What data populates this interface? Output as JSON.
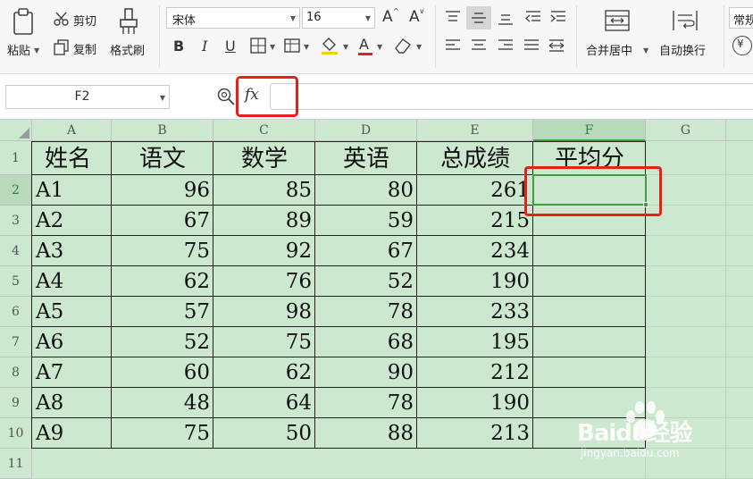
{
  "ribbon": {
    "paste_label": "粘贴",
    "cut_label": "剪切",
    "copy_label": "复制",
    "format_painter_label": "格式刷",
    "font_name": "宋体",
    "font_size": "16",
    "merge_center_label": "合并居中",
    "wrap_text_label": "自动换行",
    "number_format": "常规",
    "bold_label": "B",
    "italic_label": "I",
    "underline_label": "U",
    "font_color_label": "A",
    "increase_font_label": "A",
    "decrease_font_label": "A",
    "currency_symbol": "¥"
  },
  "formula_bar": {
    "name_box": "F2",
    "fx_label": "fx",
    "formula": ""
  },
  "sheet": {
    "columns": [
      "A",
      "B",
      "C",
      "D",
      "E",
      "F",
      "G"
    ],
    "rows": [
      "1",
      "2",
      "3",
      "4",
      "5",
      "6",
      "7",
      "8",
      "9",
      "10",
      "11"
    ],
    "headers": [
      "姓名",
      "语文",
      "数学",
      "英语",
      "总成绩",
      "平均分"
    ],
    "data": [
      [
        "A1",
        "96",
        "85",
        "80",
        "261",
        ""
      ],
      [
        "A2",
        "67",
        "89",
        "59",
        "215",
        ""
      ],
      [
        "A3",
        "75",
        "92",
        "67",
        "234",
        ""
      ],
      [
        "A4",
        "62",
        "76",
        "52",
        "190",
        ""
      ],
      [
        "A5",
        "57",
        "98",
        "78",
        "233",
        ""
      ],
      [
        "A6",
        "52",
        "75",
        "68",
        "195",
        ""
      ],
      [
        "A7",
        "60",
        "62",
        "90",
        "212",
        ""
      ],
      [
        "A8",
        "48",
        "64",
        "78",
        "190",
        ""
      ],
      [
        "A9",
        "75",
        "50",
        "88",
        "213",
        ""
      ]
    ],
    "selected_cell": "F2"
  },
  "watermark": {
    "logo_text": "Baidu经验",
    "url_text": "jingyan.baidu.com"
  },
  "colors": {
    "sheet_bg": "#cce8cf",
    "selection_border": "#3f9f3f",
    "highlight_red": "#e8201c",
    "ribbon_bg": "#f7f7f7"
  }
}
